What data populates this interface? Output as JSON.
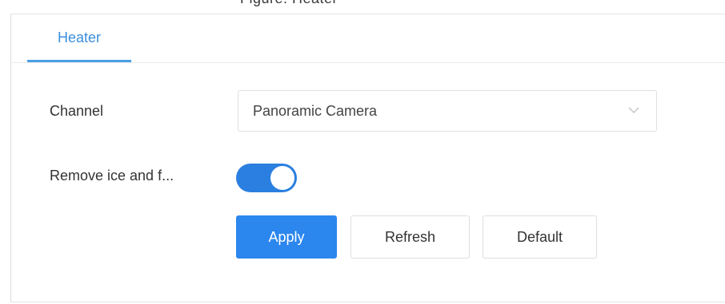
{
  "figure_caption_partial": "Figure: Heater",
  "tabs": [
    {
      "label": "Heater",
      "active": true
    }
  ],
  "form": {
    "channel": {
      "label": "Channel",
      "value": "Panoramic Camera",
      "icon": "chevron-down-icon"
    },
    "remove_ice": {
      "label": "Remove ice and f...",
      "enabled": true
    }
  },
  "buttons": {
    "apply": "Apply",
    "refresh": "Refresh",
    "default": "Default"
  },
  "colors": {
    "accent": "#2b86ee",
    "tab_active": "#3c8fdb"
  }
}
